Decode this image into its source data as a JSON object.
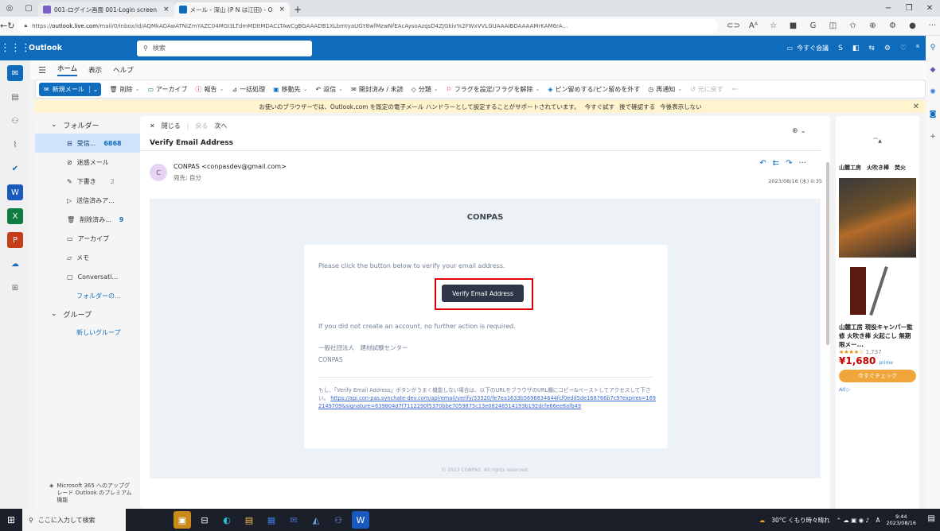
{
  "browser": {
    "tabs": [
      {
        "title": "001-ログイン画面 001-Login screen",
        "active": false
      },
      {
        "title": "メール - 深山 (P N は江田) - O",
        "active": true
      }
    ],
    "url_scheme": "https://",
    "url_host": "outlook.live.com",
    "url_path": "/mail/0/inbox/id/AQMkADAwATNiZmYAZC04MGI3LTdmMDItMDACLTAwCgBGAAADB1XLbmtyaUGY8wfMzwNfEAcAysoAzqsD4ZJGkiv%2FWxVVLGUAAAIBDAAAAMrKAM6rA..."
  },
  "outlook": {
    "brand": "Outlook",
    "search_placeholder": "検索",
    "meet_now": "今すぐ会議",
    "ribbon_tabs": [
      "ホーム",
      "表示",
      "ヘルプ"
    ],
    "commands": {
      "new_mail": "新規メール",
      "delete": "削除",
      "archive": "アーカイブ",
      "report": "報告",
      "sweep": "一括処理",
      "move_to": "移動先",
      "reply": "返信",
      "read_unread": "開封済み / 未読",
      "categorize": "分類",
      "flag": "フラグを設定/フラグを解除",
      "pin": "ピン留めする/ピン留めを外す",
      "snooze": "再通知",
      "undo": "元に戻す",
      "more": "···"
    },
    "info_bar": {
      "text": "お使いのブラウザーでは、Outlook.com を既定の電子メール ハンドラーとして設定することがサポートされています。",
      "try_now": "今すぐ試す",
      "later": "後で確認する",
      "never": "今後表示しない"
    },
    "folders": {
      "header": "フォルダー",
      "items": [
        {
          "label": "受信...",
          "count": "6868"
        },
        {
          "label": "迷惑メール",
          "count": ""
        },
        {
          "label": "下書き",
          "count": "2"
        },
        {
          "label": "送信済みア...",
          "count": ""
        },
        {
          "label": "削除済み...",
          "count": "9"
        },
        {
          "label": "アーカイブ",
          "count": ""
        },
        {
          "label": "メモ",
          "count": ""
        },
        {
          "label": "Conversati...",
          "count": ""
        }
      ],
      "more_folders": "フォルダーの...",
      "groups_header": "グループ",
      "new_group": "新しいグループ",
      "upsell": "Microsoft 365 へのアップグレード Outlook のプレミアム機能"
    },
    "reading": {
      "close": "閉じる",
      "back": "戻る",
      "next": "次へ",
      "subject": "Verify Email Address",
      "avatar_initial": "C",
      "sender": "CONPAS <conpasdev@gmail.com>",
      "to": "宛先: 自分",
      "date": "2023/08/16 (水) 0:35"
    },
    "email": {
      "header": "CONPAS",
      "intro": "Please click the button below to verify your email address.",
      "button": "Verify Email Address",
      "no_action": "If you did not create an account, no further action is required.",
      "org": "一般社団法人　建材試験センター",
      "org_sub": "CONPAS",
      "fallback_text": "もし、「Verify Email Address」ボタンがうまく機能しない場合は、以下のURLをブラウザのURL欄にコピー&ペーストしてアクセスして下さい。",
      "fallback_url": "https://api.con-pas.synchate-dev.com/api/email/verify/33320/fe7ea1633b5696834644fcf0edd5de168766b7c9?expires=1692149709&signature=639804d7f7112290f5370bbe7059875c13e08248514193b192dcfe66ee8afb49",
      "footer": "© 2023 CONPAS. All rights reserved."
    },
    "ad": {
      "brand": "山麓工房　火吹き棒　焚火",
      "title": "山麓工房 現役キャンパー監修 火吹き棒 火起こし 無期限メー...",
      "stars": "★★★★☆",
      "reviews": "1,737",
      "price": "¥1,680",
      "prime": "prime",
      "cta": "今すぐチェック",
      "badge": "Ad ▷"
    }
  },
  "taskbar": {
    "search_placeholder": "ここに入力して検索",
    "weather": "30°C くもり時々晴れ",
    "ime": "A",
    "time": "9:44",
    "date": "2023/08/16"
  }
}
